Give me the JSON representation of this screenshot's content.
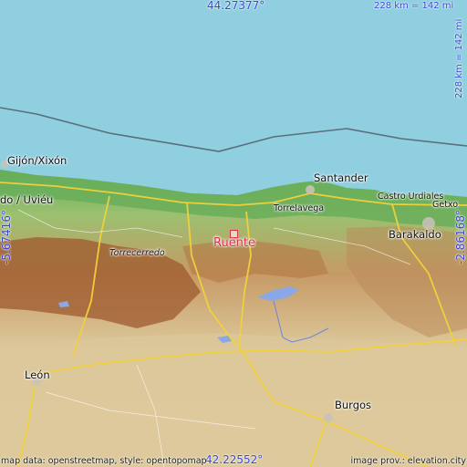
{
  "map": {
    "top_latitude": "44.27377°",
    "bottom_latitude": "42.22552°",
    "left_longitude": "-5.67416°",
    "right_longitude": "-2.86168°",
    "scale_top": "228 km = 142 mi",
    "scale_right": "228 km = 142 mi",
    "target_place": "Ruente",
    "places": {
      "gijon": "Gijón/Xixón",
      "uvieu": "do / Uviéu",
      "santander": "Santander",
      "torrelavega": "Torrelavega",
      "castro": "Castro Urdiales",
      "getxo": "Getxo",
      "barakaldo": "Barakaldo",
      "torrecerredo": "Torrecerredo",
      "leon": "León",
      "burgos": "Burgos"
    },
    "attribution_left": "map data: openstreetmap, style: opentopomap",
    "attribution_right": "image prov.: elevation.city",
    "colors": {
      "sea": "#8fcfe0",
      "lowland": "#8dc46a",
      "upland": "#c8a06a",
      "mountain": "#9e5a2e",
      "plateau": "#dcc89a",
      "roads": "#f2d23a",
      "accent": "#3a47d6",
      "target": "#e0304a"
    }
  }
}
